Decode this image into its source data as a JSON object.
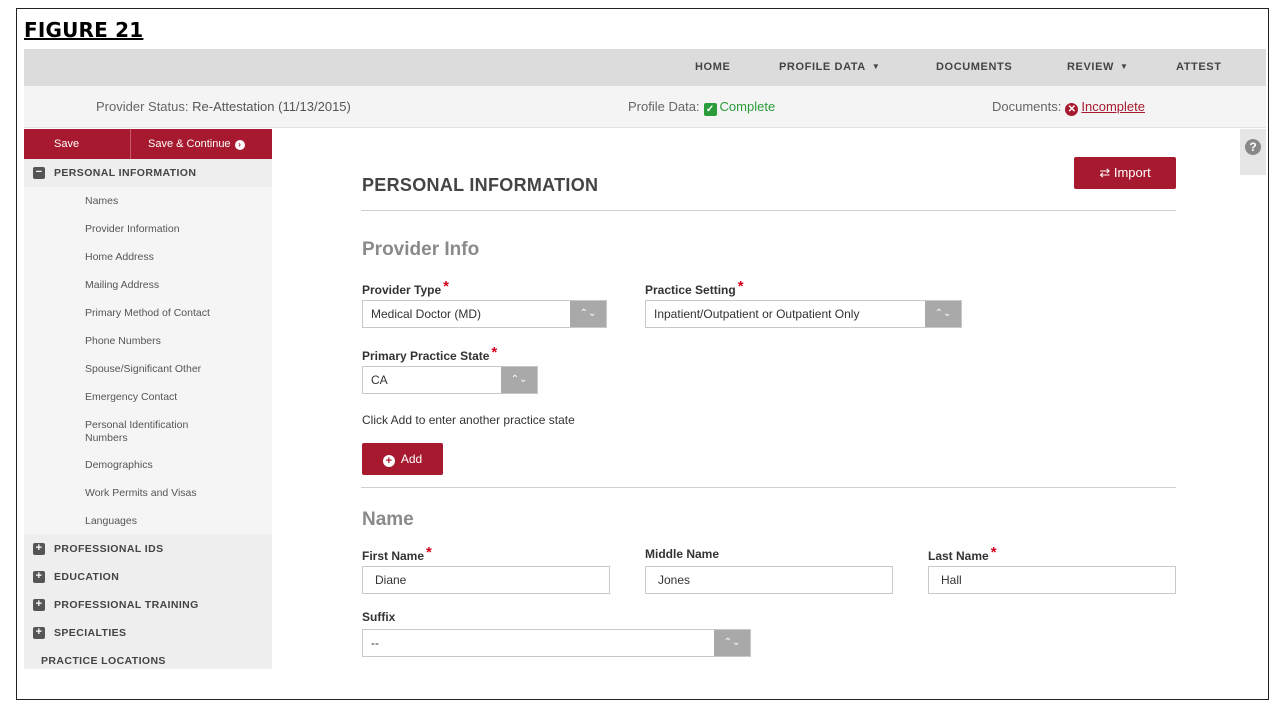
{
  "figure_caption": "FIGURE 21",
  "nav": {
    "home": "HOME",
    "profile_data": "PROFILE DATA",
    "documents": "DOCUMENTS",
    "review": "REVIEW",
    "attest": "ATTEST"
  },
  "status": {
    "provider_label": "Provider Status:",
    "provider_value": "Re-Attestation (11/13/2015)",
    "profile_label": "Profile Data:",
    "profile_value": "Complete",
    "documents_label": "Documents:",
    "documents_value": "Incomplete"
  },
  "sidebar": {
    "save": "Save",
    "save_continue": "Save & Continue",
    "personal_information": "PERSONAL INFORMATION",
    "subitems": [
      "Names",
      "Provider Information",
      "Home Address",
      "Mailing Address",
      "Primary Method of Contact",
      "Phone Numbers",
      "Spouse/Significant Other",
      "Emergency Contact",
      "Personal Identification Numbers",
      "Demographics",
      "Work Permits and Visas",
      "Languages"
    ],
    "professional_ids": "PROFESSIONAL IDS",
    "education": "EDUCATION",
    "professional_training": "PROFESSIONAL TRAINING",
    "specialties": "SPECIALTIES",
    "practice_locations": "PRACTICE LOCATIONS"
  },
  "main": {
    "heading": "PERSONAL INFORMATION",
    "import": "Import",
    "provider_info": "Provider Info",
    "provider_type_label": "Provider Type",
    "provider_type_value": "Medical Doctor (MD)",
    "practice_setting_label": "Practice Setting",
    "practice_setting_value": "Inpatient/Outpatient or Outpatient Only",
    "primary_state_label": "Primary Practice State",
    "primary_state_value": "CA",
    "hint": "Click Add to enter another practice state",
    "add": "Add",
    "name_heading": "Name",
    "first_name_label": "First Name",
    "first_name_value": "Diane",
    "middle_name_label": "Middle Name",
    "middle_name_value": "Jones",
    "last_name_label": "Last Name",
    "last_name_value": "Hall",
    "suffix_label": "Suffix",
    "suffix_value": "--"
  },
  "colors": {
    "brand": "#a6192e",
    "success": "#2a9c3a"
  }
}
